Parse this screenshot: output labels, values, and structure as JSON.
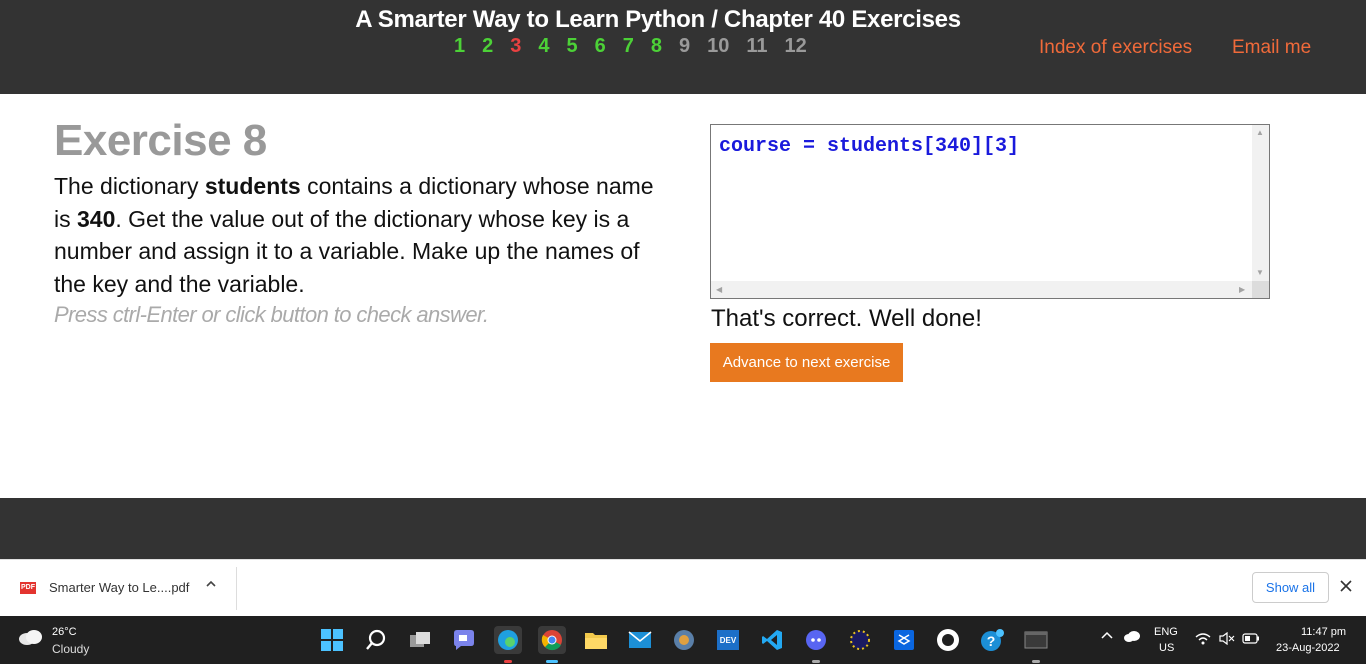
{
  "header": {
    "title": "A Smarter Way to Learn Python / Chapter 40 Exercises",
    "exercise_numbers": [
      {
        "label": "1",
        "color": "#4cd137"
      },
      {
        "label": "2",
        "color": "#4cd137"
      },
      {
        "label": "3",
        "color": "#e84141"
      },
      {
        "label": "4",
        "color": "#4cd137"
      },
      {
        "label": "5",
        "color": "#4cd137"
      },
      {
        "label": "6",
        "color": "#4cd137"
      },
      {
        "label": "7",
        "color": "#4cd137"
      },
      {
        "label": "8",
        "color": "#4cd137"
      },
      {
        "label": "9",
        "color": "#9a9a9a"
      },
      {
        "label": "10",
        "color": "#9a9a9a"
      },
      {
        "label": "11",
        "color": "#9a9a9a"
      },
      {
        "label": "12",
        "color": "#9a9a9a"
      }
    ],
    "index_link": "Index of exercises",
    "email_link": "Email me"
  },
  "exercise": {
    "title": "Exercise 8",
    "text_1": "The dictionary ",
    "bold_1": "students",
    "text_2": " contains a dictionary whose name is ",
    "bold_2": "340",
    "text_3": ". Get the value out of the dictionary whose key is a number and assign it to a variable. Make up the names of the key and the variable.",
    "hint": "Press ctrl-Enter or click button to check answer."
  },
  "editor": {
    "code": "course = students[340][3]"
  },
  "result": {
    "message": "That's correct. Well done!",
    "advance_button": "Advance to next exercise"
  },
  "downloads": {
    "file_icon_text": "PDF",
    "file_name": "Smarter Way to Le....pdf",
    "show_all": "Show all"
  },
  "taskbar": {
    "temperature": "26°C",
    "weather": "Cloudy",
    "language": "ENG",
    "region": "US",
    "time": "11:47 pm",
    "date": "23-Aug-2022"
  }
}
